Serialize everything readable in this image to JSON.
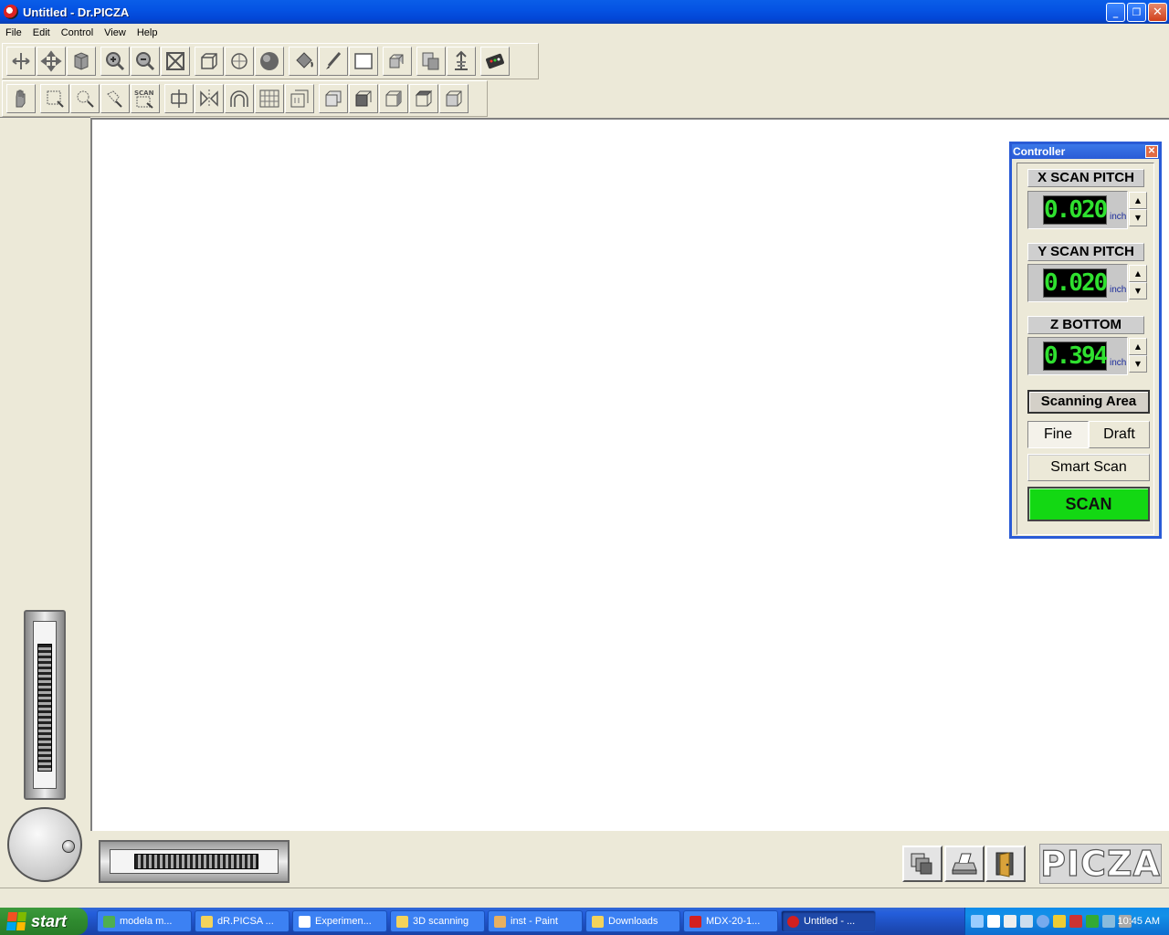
{
  "window": {
    "title": "Untitled - Dr.PICZA"
  },
  "menu": [
    "File",
    "Edit",
    "Control",
    "View",
    "Help"
  ],
  "toolbar1_icons": [
    "select-icon",
    "move-icon",
    "rotate-icon",
    "zoom-in-icon",
    "zoom-out-icon",
    "zoom-fit-icon",
    "wireframe-icon",
    "polygon-icon",
    "shaded-icon",
    "paint-bucket-icon",
    "brush-icon",
    "rectangle-icon",
    "cube-stack-icon",
    "copy-icon",
    "filter-icon",
    "controller-icon"
  ],
  "toolbar2_icons": [
    "hand-icon",
    "select-rect-icon",
    "select-lasso-icon",
    "select-free-icon",
    "scan-area-icon",
    "mirror-h-icon",
    "mirror-v-icon",
    "arch-icon",
    "grid-icon",
    "resize-icon",
    "view-front-icon",
    "view-side-icon",
    "view-top-icon",
    "view-iso-icon",
    "view-back-icon"
  ],
  "toolbar2_scan_label": "SCAN",
  "controller": {
    "title": "Controller",
    "x_label": "X SCAN PITCH",
    "x_value": "0.020",
    "y_label": "Y SCAN PITCH",
    "y_value": "0.020",
    "z_label": "Z BOTTOM",
    "z_value": "0.394",
    "unit": "inch",
    "area_button": "Scanning Area",
    "fine": "Fine",
    "draft": "Draft",
    "smart_scan": "Smart Scan",
    "scan": "SCAN"
  },
  "logo": "PICZA",
  "taskbar": {
    "start": "start",
    "tasks": [
      {
        "label": "modela m...",
        "color": "#4fae4f"
      },
      {
        "label": "dR.PICSA ...",
        "color": "#f3d35b"
      },
      {
        "label": "Experimen...",
        "color": "#ffffff"
      },
      {
        "label": "3D scanning",
        "color": "#f3d35b"
      },
      {
        "label": "inst - Paint",
        "color": "#e8b060"
      },
      {
        "label": "Downloads",
        "color": "#f3d35b"
      },
      {
        "label": "MDX-20-1...",
        "color": "#d22020"
      },
      {
        "label": "Untitled - ...",
        "color": "#d22020"
      }
    ],
    "clock": "10:45 AM"
  }
}
